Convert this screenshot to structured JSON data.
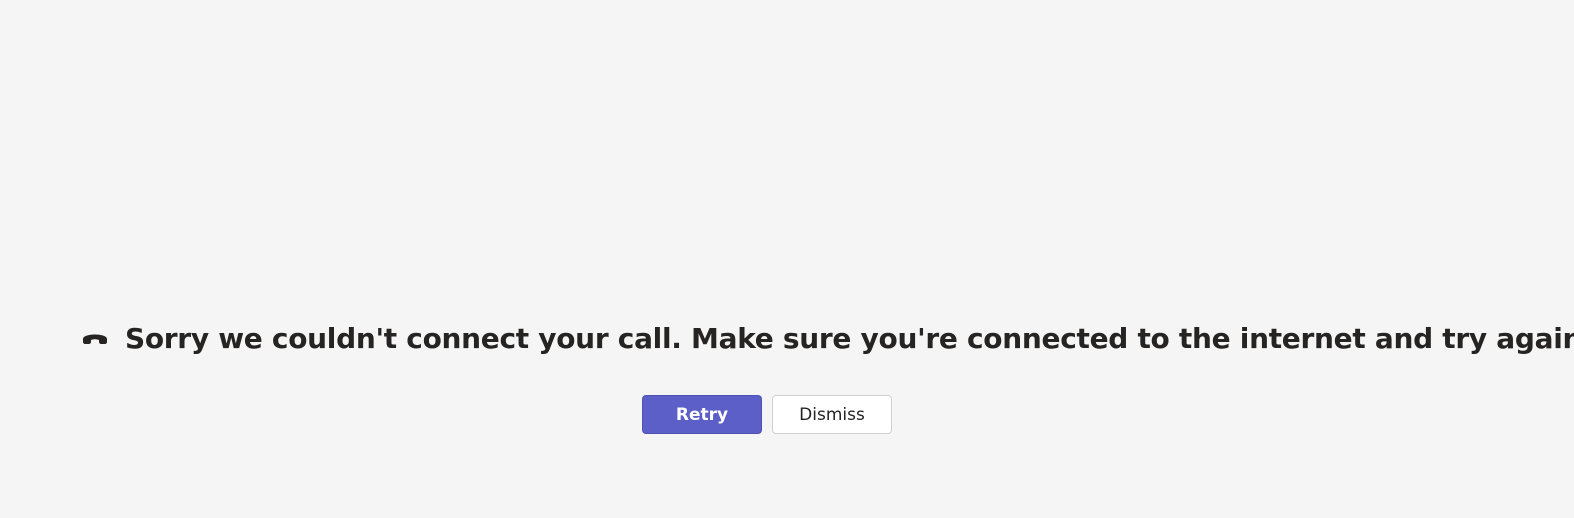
{
  "error": {
    "icon": "phone-hangup-icon",
    "message": "Sorry we couldn't connect your call. Make sure you're connected to the internet and try again."
  },
  "actions": {
    "retry_label": "Retry",
    "dismiss_label": "Dismiss"
  },
  "colors": {
    "background": "#f5f5f5",
    "text": "#252423",
    "primary": "#5b5fc7",
    "secondary_border": "#d1d1d1"
  }
}
